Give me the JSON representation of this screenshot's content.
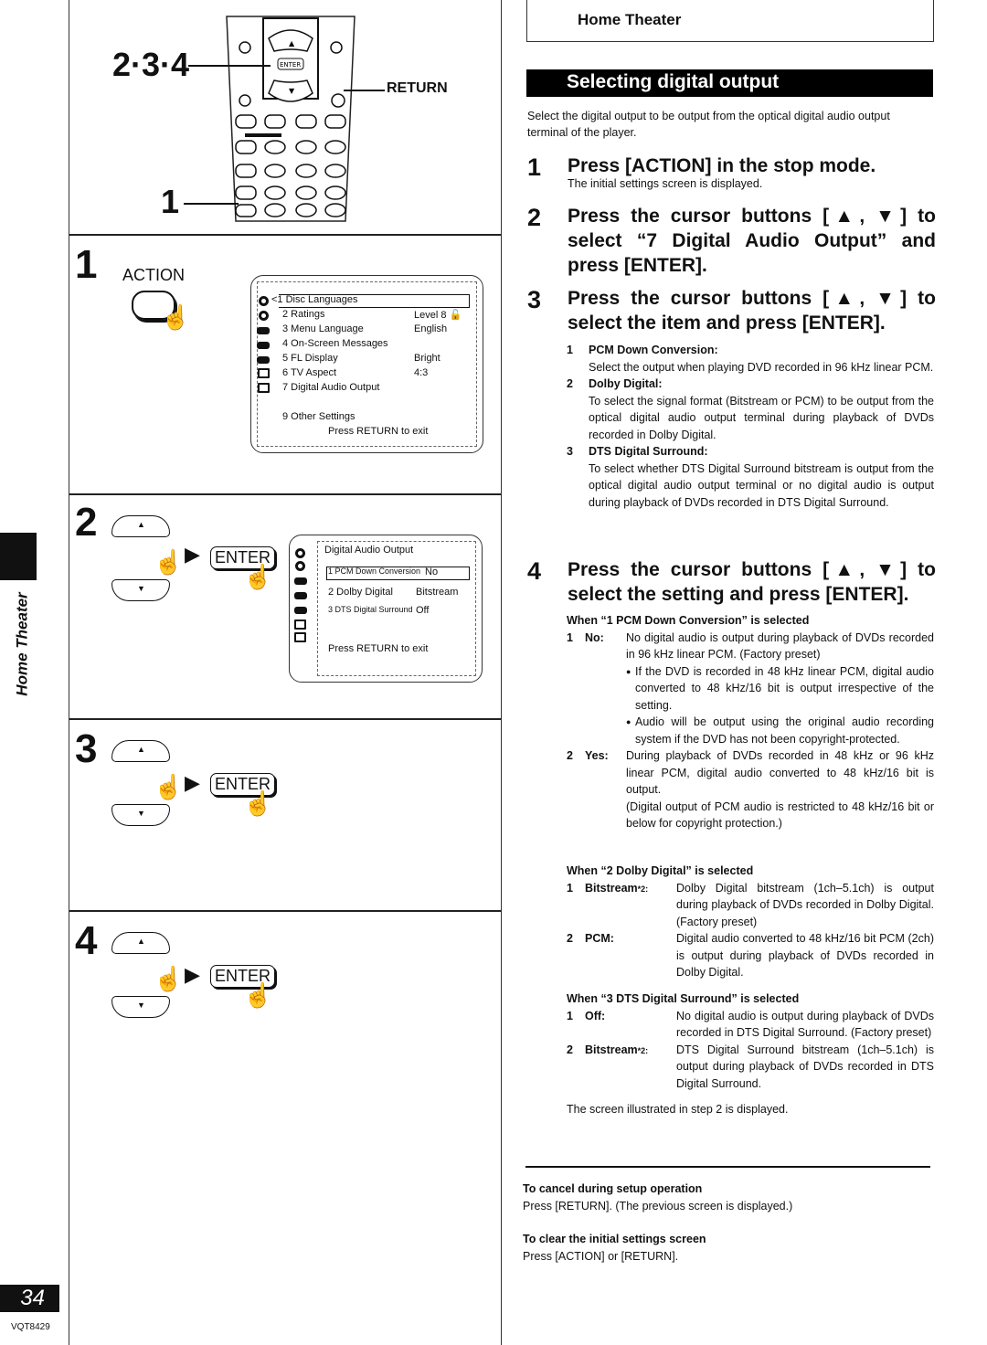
{
  "sidebar": {
    "section_label": "Home Theater",
    "page_number": "34",
    "doc_code": "VQT8429"
  },
  "remote": {
    "label_steps_234": "2·3·4",
    "label_step_1": "1",
    "label_return": "RETURN",
    "buttons": {
      "up": "▲",
      "down": "▼",
      "enter": "ENTER"
    }
  },
  "left_steps": [
    {
      "number": "1",
      "button_label": "ACTION"
    },
    {
      "number": "2",
      "enter_label": "ENTER"
    },
    {
      "number": "3",
      "enter_label": "ENTER"
    },
    {
      "number": "4",
      "enter_label": "ENTER"
    }
  ],
  "osd_initial": {
    "rows": [
      {
        "label": "<1 Disc Languages",
        "value": ""
      },
      {
        "label": "2 Ratings",
        "value": "Level 8 🔓"
      },
      {
        "label": "3 Menu Language",
        "value": "English"
      },
      {
        "label": "4 On-Screen Messages",
        "value": ""
      },
      {
        "label": "5 FL Display",
        "value": "Bright"
      },
      {
        "label": "6 TV Aspect",
        "value": "4:3"
      },
      {
        "label": "7 Digital Audio Output",
        "value": ""
      },
      {
        "label": "9 Other Settings",
        "value": ""
      }
    ],
    "footer": "Press RETURN to exit"
  },
  "osd_digital": {
    "title": "Digital Audio Output",
    "rows": [
      {
        "label": "1 PCM Down Conversion",
        "value": "No"
      },
      {
        "label": "2 Dolby Digital",
        "value": "Bitstream"
      },
      {
        "label": "3 DTS Digital Surround",
        "value": "Off"
      }
    ],
    "footer": "Press RETURN to exit"
  },
  "header": {
    "section": "Home Theater",
    "title": "Selecting digital output"
  },
  "intro": "Select the digital output to be output from the optical digital audio output terminal of the player.",
  "steps": [
    {
      "number": "1",
      "heading": "Press [ACTION] in the stop mode.",
      "sub": "The initial settings screen is displayed."
    },
    {
      "number": "2",
      "heading": "Press the cursor buttons [▲, ▼] to select “7 Digital Audio Output” and press [ENTER]."
    },
    {
      "number": "3",
      "heading": "Press the cursor buttons [▲, ▼] to select the item and press [ENTER]."
    },
    {
      "number": "4",
      "heading": "Press the cursor buttons [▲, ▼] to select the setting and press [ENTER]."
    }
  ],
  "items": [
    {
      "num": "1",
      "title": "PCM Down Conversion:",
      "desc": "Select the output when playing DVD recorded in 96 kHz linear PCM."
    },
    {
      "num": "2",
      "title": "Dolby Digital:",
      "desc": "To select the signal format (Bitstream or PCM) to be output from the optical digital audio output terminal during playback of DVDs recorded in Dolby Digital."
    },
    {
      "num": "3",
      "title": "DTS Digital Surround:",
      "desc": "To select whether DTS Digital Surround bitstream is output from the optical digital audio output terminal or no digital audio is output during playback of DVDs recorded in DTS Digital Surround."
    }
  ],
  "pcm_section": {
    "heading": "When “1 PCM Down Conversion” is selected",
    "options": [
      {
        "num": "1",
        "label": "No:",
        "desc": "No digital audio is output during playback of DVDs recorded in 96 kHz linear PCM. (Factory preset)",
        "bullets": [
          "If the DVD is recorded in 48 kHz linear PCM, digital audio converted to 48 kHz/16 bit is output irrespective of the setting.",
          "Audio will be output using the original audio recording system if the DVD has not been copyright-protected."
        ]
      },
      {
        "num": "2",
        "label": "Yes:",
        "desc": "During playback of DVDs recorded in 48 kHz or 96 kHz linear PCM, digital audio converted to 48 kHz/16 bit is output.",
        "note": "(Digital output of PCM audio is restricted to 48 kHz/16 bit or below for copyright protection.)"
      }
    ]
  },
  "dolby_section": {
    "heading": "When “2 Dolby Digital” is selected",
    "options": [
      {
        "num": "1",
        "label": "Bitstream",
        "mark": "*2:",
        "desc": "Dolby Digital bitstream (1ch–5.1ch) is output during playback of DVDs recorded in Dolby Digital. (Factory preset)"
      },
      {
        "num": "2",
        "label": "PCM:",
        "mark": "",
        "desc": "Digital audio converted to 48 kHz/16 bit PCM (2ch) is output during playback of DVDs recorded in Dolby Digital."
      }
    ]
  },
  "dts_section": {
    "heading": "When “3 DTS Digital Surround” is selected",
    "options": [
      {
        "num": "1",
        "label": "Off:",
        "mark": "",
        "desc": "No digital audio is output during playback of DVDs recorded in DTS Digital Surround. (Factory preset)"
      },
      {
        "num": "2",
        "label": "Bitstream",
        "mark": "*2:",
        "desc": "DTS Digital Surround bitstream (1ch–5.1ch) is output during playback of DVDs recorded in DTS Digital Surround."
      }
    ]
  },
  "closing": "The screen illustrated in step 2 is displayed.",
  "notes": [
    {
      "title": "To cancel during setup operation",
      "text": "Press [RETURN]. (The previous screen is displayed.)"
    },
    {
      "title": "To clear the initial settings screen",
      "text": "Press [ACTION] or [RETURN]."
    }
  ]
}
